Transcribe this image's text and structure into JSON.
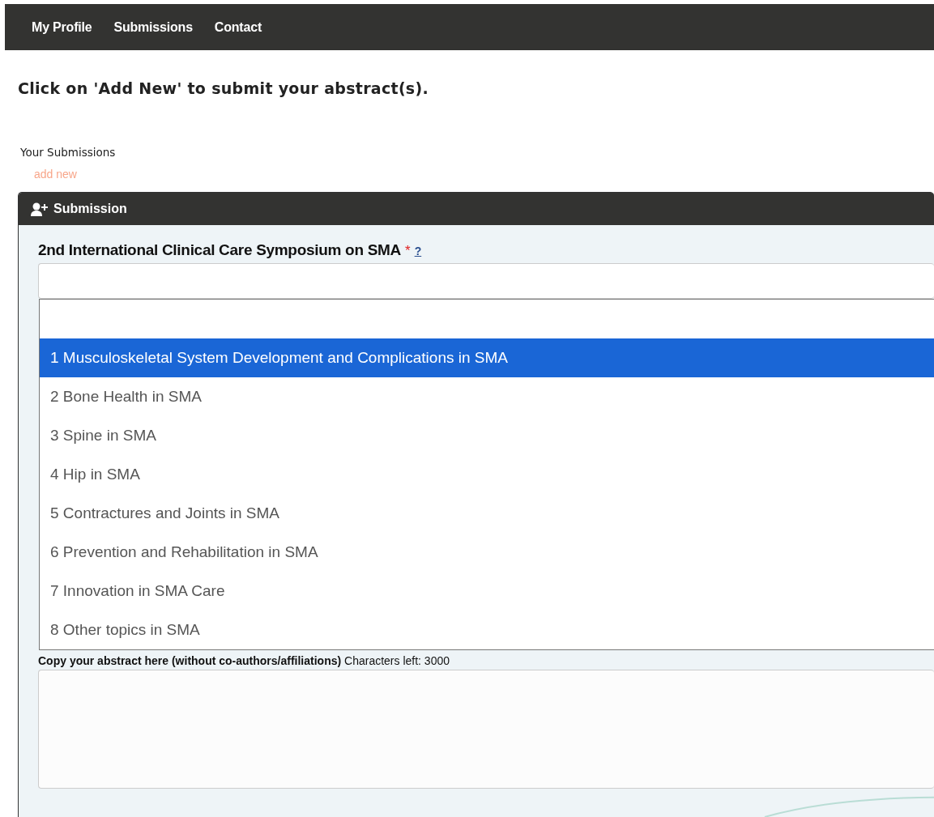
{
  "nav": {
    "items": [
      {
        "label": "My Profile"
      },
      {
        "label": "Submissions"
      },
      {
        "label": "Contact"
      }
    ]
  },
  "heading": "Click on 'Add New' to submit your abstract(s).",
  "submissions": {
    "title": "Your Submissions",
    "add_link": "add new"
  },
  "panel": {
    "title": "Submission",
    "field": {
      "label": "2nd International Clinical Care Symposium on SMA",
      "required_mark": "*",
      "help": "?"
    },
    "options": [
      {
        "label": "1 Musculoskeletal System Development and Complications in SMA",
        "selected": true
      },
      {
        "label": "2 Bone Health in SMA",
        "selected": false
      },
      {
        "label": "3 Spine in SMA",
        "selected": false
      },
      {
        "label": "4 Hip in SMA",
        "selected": false
      },
      {
        "label": "5 Contractures and Joints in SMA",
        "selected": false
      },
      {
        "label": "6 Prevention and Rehabilitation in SMA",
        "selected": false
      },
      {
        "label": "7 Innovation in SMA Care",
        "selected": false
      },
      {
        "label": "8 Other topics in SMA",
        "selected": false
      }
    ],
    "abstract": {
      "label": "**Copy your abstract here (without co-authors/affiliations)** Characters left: 3000"
    }
  }
}
